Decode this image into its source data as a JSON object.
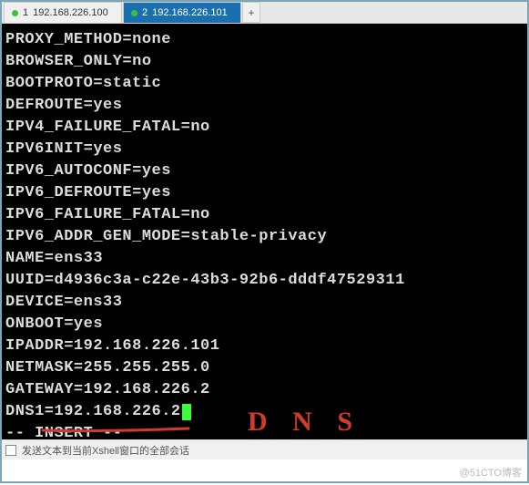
{
  "tabs": [
    {
      "index": "1",
      "label": "192.168.226.100",
      "active": false
    },
    {
      "index": "2",
      "label": "192.168.226.101",
      "active": true
    }
  ],
  "add_tab": "+",
  "terminal": {
    "lines": [
      "PROXY_METHOD=none",
      "BROWSER_ONLY=no",
      "BOOTPROTO=static",
      "DEFROUTE=yes",
      "IPV4_FAILURE_FATAL=no",
      "IPV6INIT=yes",
      "IPV6_AUTOCONF=yes",
      "IPV6_DEFROUTE=yes",
      "IPV6_FAILURE_FATAL=no",
      "IPV6_ADDR_GEN_MODE=stable-privacy",
      "NAME=ens33",
      "UUID=d4936c3a-c22e-43b3-92b6-dddf47529311",
      "DEVICE=ens33",
      "ONBOOT=yes",
      "IPADDR=192.168.226.101",
      "NETMASK=255.255.255.0",
      "GATEWAY=192.168.226.2",
      "DNS1=192.168.226.2"
    ],
    "mode": "-- INSERT --"
  },
  "bottom": {
    "label": "发送文本到当前Xshell窗口的全部会话"
  },
  "annotation_text": "D N S",
  "watermark": "@51CTO博客"
}
